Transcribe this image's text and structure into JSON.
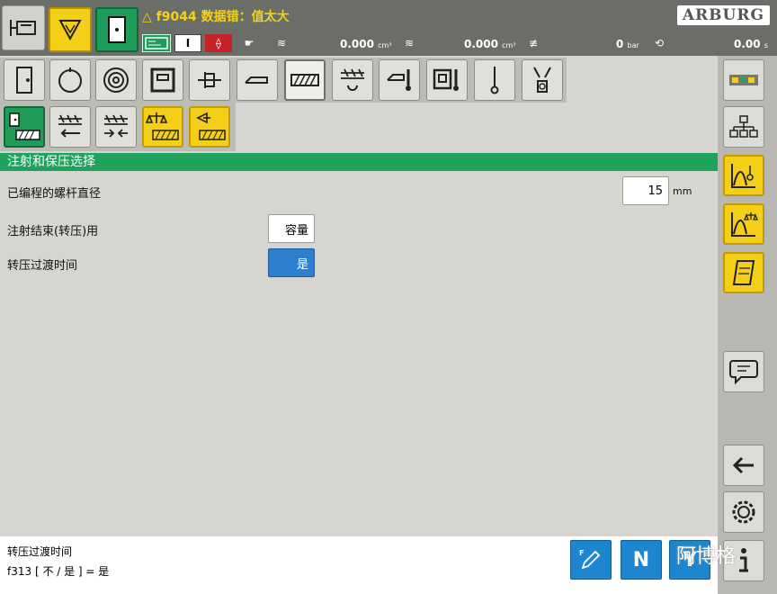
{
  "alarm": {
    "code": "f9044",
    "text": "数据错：值太大"
  },
  "brand": {
    "logo_text": "ARBURG"
  },
  "status": {
    "vol1": "0.000",
    "vol1_unit": "cm³",
    "vol2": "0.000",
    "vol2_unit": "cm³",
    "pressure": "0",
    "pressure_unit": "bar",
    "time": "0.00",
    "time_unit": "s"
  },
  "section_title": "注射和保压选择",
  "params": {
    "screw_diameter_label": "已编程的螺杆直径",
    "screw_diameter_value": "15",
    "screw_diameter_unit": "mm",
    "injection_end_label": "注射结束(转压)用",
    "injection_end_value": "容量",
    "transition_label": "转压过渡时间",
    "transition_value": "是"
  },
  "footer": {
    "line1": "转压过渡时间",
    "line2": "f313 [ 不 / 是 ] =  是"
  },
  "watermark": {
    "brand": "阿博格"
  },
  "colors": {
    "accent_green": "#1fa25c",
    "accent_yellow": "#f4cf1a",
    "select_blue": "#2f7fd0"
  }
}
